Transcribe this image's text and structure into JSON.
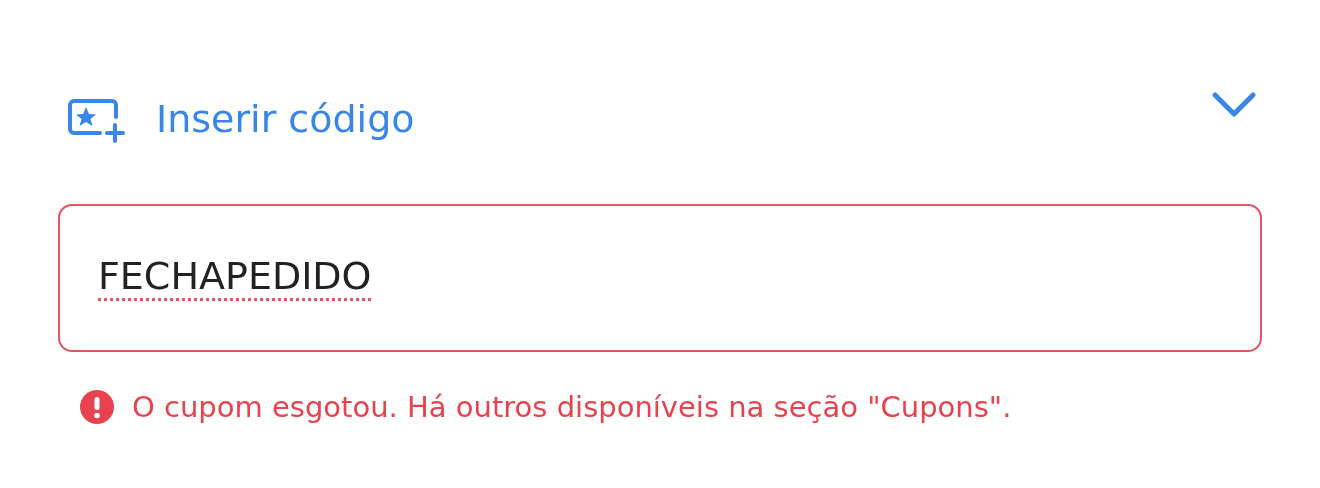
{
  "coupon_section": {
    "title": "Inserir código"
  },
  "code_field": {
    "value": "FECHAPEDIDO",
    "invalid": true,
    "misspelled": true
  },
  "error_message": "O cupom esgotou. Há outros disponíveis na seção \"Cupons\"."
}
